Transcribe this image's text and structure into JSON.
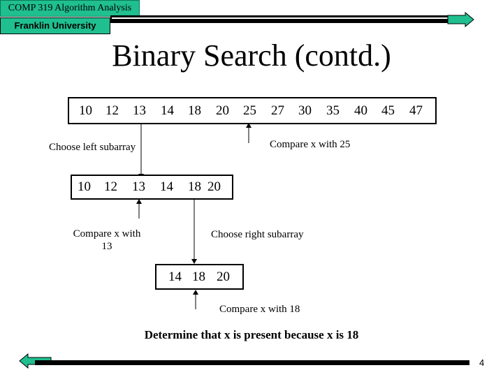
{
  "header": {
    "course": "COMP 319 Algorithm Analysis",
    "university": "Franklin University",
    "accent_color": "#1fbf8f"
  },
  "slide": {
    "title": "Binary Search (contd.)",
    "full_array": [
      "10",
      "12",
      "13",
      "14",
      "18",
      "20",
      "25",
      "27",
      "30",
      "35",
      "40",
      "45",
      "47"
    ],
    "left_subarray": [
      "10",
      "12",
      "13",
      "14",
      "18",
      "20"
    ],
    "right_subarray": [
      "14",
      "18",
      "20"
    ],
    "labels": {
      "compare_25": "Compare x with 25",
      "choose_left": "Choose left subarray",
      "compare_13_line1": "Compare x with",
      "compare_13_line2": "13",
      "choose_right": "Choose right subarray",
      "compare_18": "Compare x with 18"
    },
    "conclusion": "Determine that x is present because x is 18"
  },
  "footer": {
    "page_number": "4",
    "next_icon": "arrow-right-icon",
    "prev_icon": "arrow-left-icon"
  }
}
